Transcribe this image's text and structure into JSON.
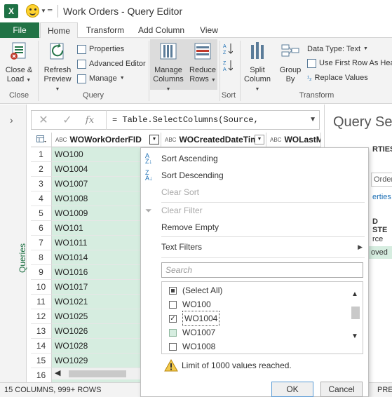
{
  "window": {
    "app_logo": "X",
    "title": "Work Orders - Query Editor",
    "quick_access": [
      "smiley-feedback-icon",
      "customize-arrow-icon"
    ]
  },
  "tabs": [
    "File",
    "Home",
    "Transform",
    "Add Column",
    "View"
  ],
  "ribbon": {
    "close": {
      "button": "Close & Load",
      "line1": "Close &",
      "line2": "Load",
      "group": "Close"
    },
    "query": {
      "refresh_line1": "Refresh",
      "refresh_line2": "Preview",
      "properties": "Properties",
      "advanced_editor": "Advanced Editor",
      "manage": "Manage",
      "group": "Query"
    },
    "manage_columns": {
      "line1": "Manage",
      "line2": "Columns"
    },
    "reduce_rows": {
      "line1": "Reduce",
      "line2": "Rows"
    },
    "sort": {
      "group": "Sort"
    },
    "transform": {
      "split_line1": "Split",
      "split_line2": "Column",
      "group_line1": "Group",
      "group_line2": "By",
      "data_type": "Data Type: Text",
      "first_row": "Use First Row As Headers",
      "replace": "Replace Values",
      "group": "Transform"
    }
  },
  "formula": {
    "text": "= Table.SelectColumns(Source,"
  },
  "left_pane": {
    "label": "Queries"
  },
  "grid": {
    "columns": [
      "WOWorkOrderFID",
      "WOCreatedDateTime",
      "WOLastMo"
    ],
    "rows": [
      {
        "n": "1",
        "v": "WO100"
      },
      {
        "n": "2",
        "v": "WO1004"
      },
      {
        "n": "3",
        "v": "WO1007"
      },
      {
        "n": "4",
        "v": "WO1008"
      },
      {
        "n": "5",
        "v": "WO1009"
      },
      {
        "n": "6",
        "v": "WO101"
      },
      {
        "n": "7",
        "v": "WO1011"
      },
      {
        "n": "8",
        "v": "WO1014"
      },
      {
        "n": "9",
        "v": "WO1016"
      },
      {
        "n": "10",
        "v": "WO1017"
      },
      {
        "n": "11",
        "v": "WO1021"
      },
      {
        "n": "12",
        "v": "WO1025"
      },
      {
        "n": "13",
        "v": "WO1026"
      },
      {
        "n": "14",
        "v": "WO1028"
      },
      {
        "n": "15",
        "v": "WO1029"
      },
      {
        "n": "16",
        "v": ""
      }
    ]
  },
  "status": {
    "left": "15 COLUMNS, 999+ ROWS",
    "right": "PRE"
  },
  "query_settings": {
    "title": "Query Set",
    "properties_header": "RTIES",
    "name_value": "Orders",
    "all_properties": "erties",
    "applied_steps_header": "D STE",
    "steps": [
      "rce",
      "oved"
    ]
  },
  "filter_menu": {
    "sort_asc": "Sort Ascending",
    "sort_desc": "Sort Descending",
    "clear_sort": "Clear Sort",
    "clear_filter": "Clear Filter",
    "remove_empty": "Remove Empty",
    "text_filters": "Text Filters",
    "search_placeholder": "Search",
    "items": [
      {
        "label": "(Select All)",
        "state": "partial"
      },
      {
        "label": "WO100",
        "state": "unchecked"
      },
      {
        "label": "WO1004",
        "state": "checked"
      },
      {
        "label": "WO1007",
        "state": "highlighted"
      },
      {
        "label": "WO1008",
        "state": "unchecked"
      }
    ],
    "limit_warning": "Limit of 1000 values reached.",
    "ok": "OK",
    "cancel": "Cancel"
  }
}
